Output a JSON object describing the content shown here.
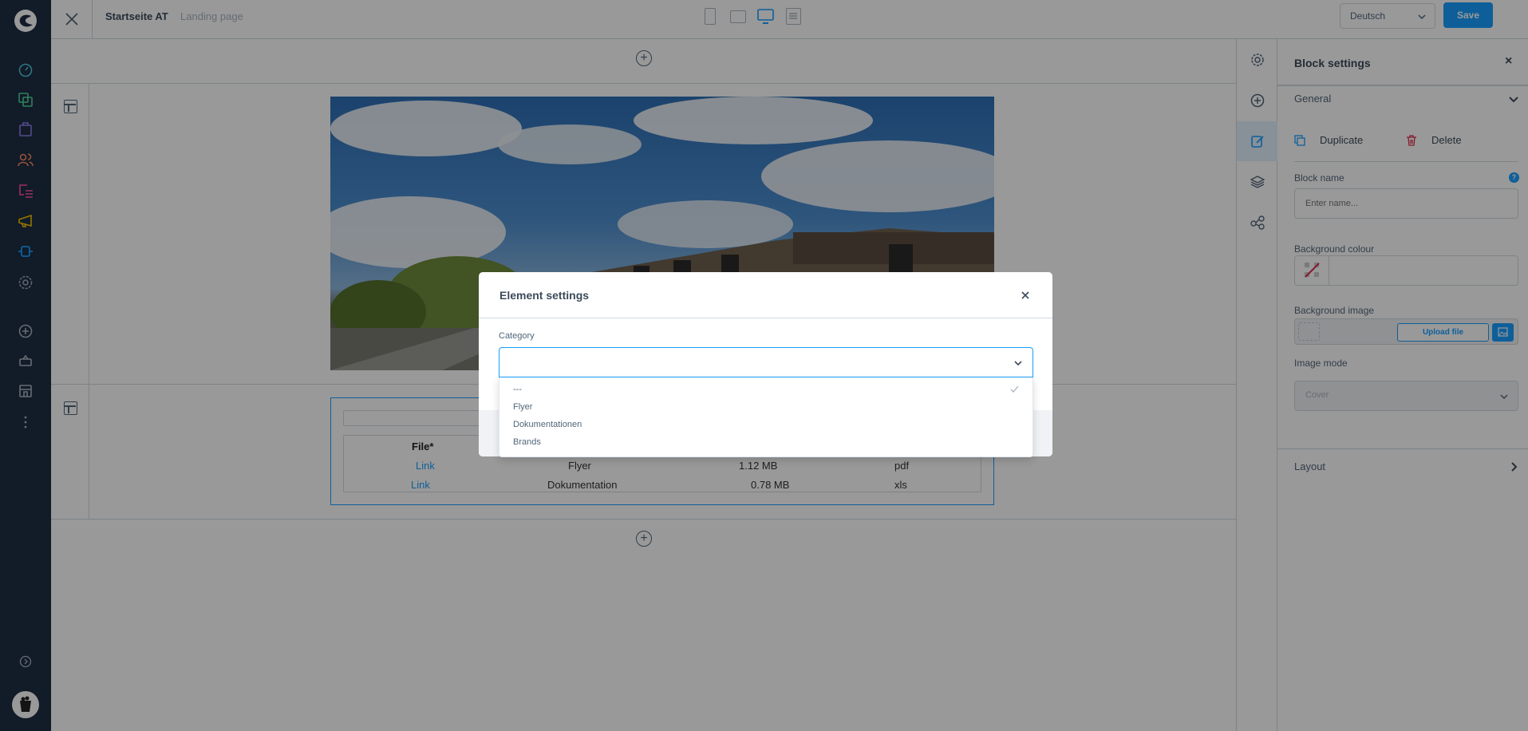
{
  "topbar": {
    "title": "Startseite AT",
    "subtitle": "Landing page",
    "language": "Deutsch",
    "save_label": "Save",
    "viewports": [
      "mobile",
      "tablet",
      "desktop",
      "list"
    ],
    "active_viewport": "desktop"
  },
  "sidebar": {
    "items": [
      {
        "icon": "dashboard-icon",
        "color": "#57d9a3"
      },
      {
        "icon": "catalogue-icon",
        "color": "#57d9a3"
      },
      {
        "icon": "orders-icon",
        "color": "#a092f0"
      },
      {
        "icon": "customers-icon",
        "color": "#f88962"
      },
      {
        "icon": "content-icon",
        "color": "#ff68b4"
      },
      {
        "icon": "marketing-icon",
        "color": "#ffd700"
      },
      {
        "icon": "extensions-icon",
        "color": "#189eff"
      },
      {
        "icon": "settings-icon",
        "color": "#9aa8b5"
      }
    ],
    "bottom": [
      "add-icon",
      "basket-icon",
      "store-icon",
      "more-icon"
    ]
  },
  "table": {
    "header": "File*",
    "rows": [
      [
        "Link",
        "Flyer",
        "1.12 MB",
        "pdf"
      ],
      [
        "Link",
        "Dokumentation",
        "0.78 MB",
        "xls"
      ]
    ]
  },
  "panel": {
    "title": "Block settings",
    "general": "General",
    "duplicate": "Duplicate",
    "delete": "Delete",
    "block_name_label": "Block name",
    "block_name_placeholder": "Enter name...",
    "bg_colour_label": "Background colour",
    "bg_image_label": "Background image",
    "upload_label": "Upload file",
    "image_mode_label": "Image mode",
    "image_mode_value": "Cover",
    "layout": "Layout"
  },
  "modal": {
    "title": "Element settings",
    "category_label": "Category",
    "category_value": "",
    "options": [
      "---",
      "Flyer",
      "Dokumentationen",
      "Brands"
    ],
    "selected_option": "---"
  },
  "colors": {
    "accent": "#189eff",
    "save": "#189eff",
    "delete": "#de294c",
    "sidebar": "#1f2d44"
  }
}
